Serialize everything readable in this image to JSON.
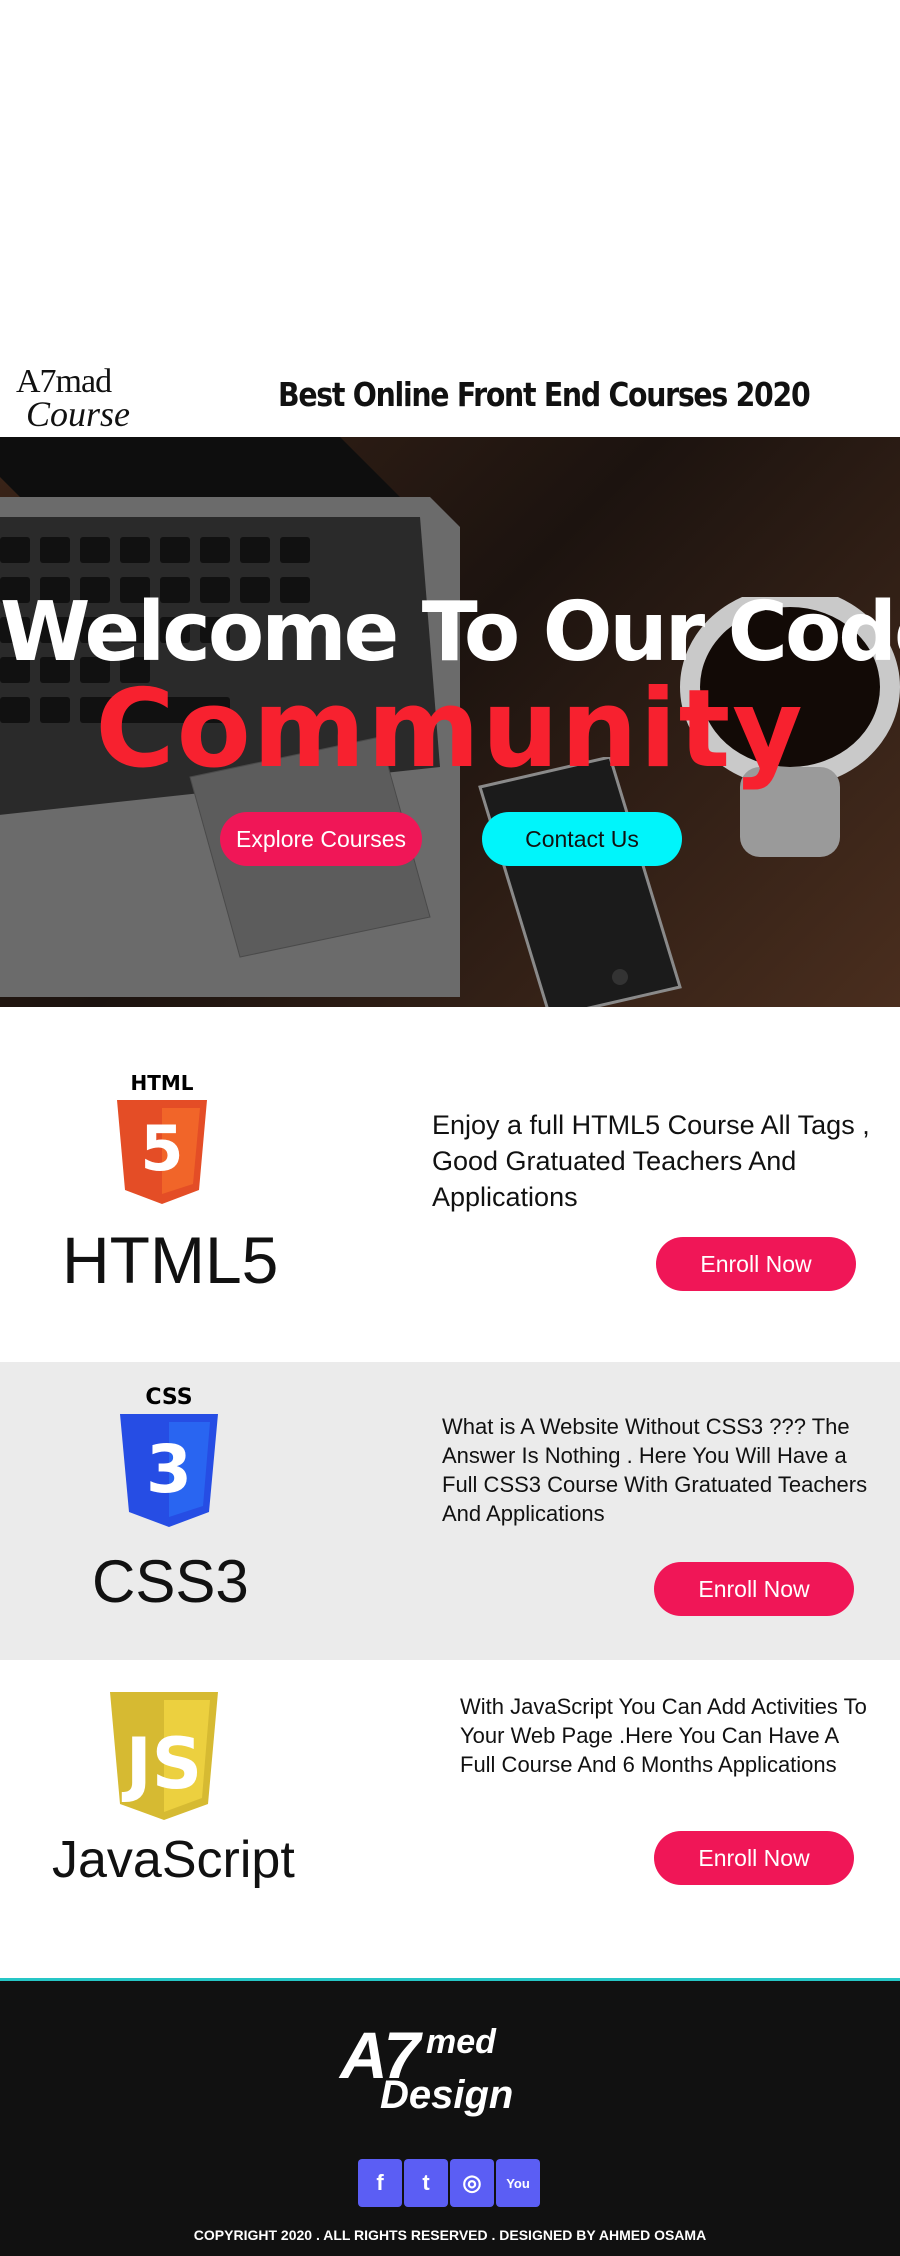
{
  "header": {
    "logo": {
      "line1": "A7mad",
      "line2": "Course"
    },
    "title": "Best Online Front End Courses 2020"
  },
  "hero": {
    "title": "Welcome To Our Coderz",
    "subtitle": "Community",
    "explore_button": "Explore Courses",
    "contact_button": "Contact Us"
  },
  "courses": [
    {
      "icon": "html5-icon",
      "name": "HTML5",
      "description": "Enjoy a full HTML5 Course All Tags , Good Gratuated Teachers And Applications",
      "button": "Enroll Now"
    },
    {
      "icon": "css3-icon",
      "name": "CSS3",
      "description": "What is A Website Without CSS3 ??? The Answer Is Nothing . Here You Will Have a Full CSS3 Course With Gratuated Teachers And Applications",
      "button": "Enroll Now"
    },
    {
      "icon": "javascript-icon",
      "name": "JavaScript",
      "description": "With JavaScript You Can Add Activities To Your Web Page .Here You Can Have A Full Course And 6 Months Applications",
      "button": "Enroll Now"
    }
  ],
  "footer": {
    "logo": {
      "a7": "A7",
      "med": "med",
      "design": "Design"
    },
    "socials": [
      {
        "icon": "facebook-icon",
        "glyph": "f"
      },
      {
        "icon": "twitter-icon",
        "glyph": "t"
      },
      {
        "icon": "instagram-icon",
        "glyph": "◎"
      },
      {
        "icon": "youtube-icon",
        "glyph": "You"
      }
    ],
    "copyright": "COPYRIGHT 2020 . ALL RIGHTS RESERVED . DESIGNED BY AHMED OSAMA"
  },
  "colors": {
    "accent_pink": "#f01657",
    "accent_cyan": "#00f5fb",
    "hero_red": "#f7212f",
    "social_blue": "#5b5ef4",
    "footer_bg": "#111111"
  }
}
